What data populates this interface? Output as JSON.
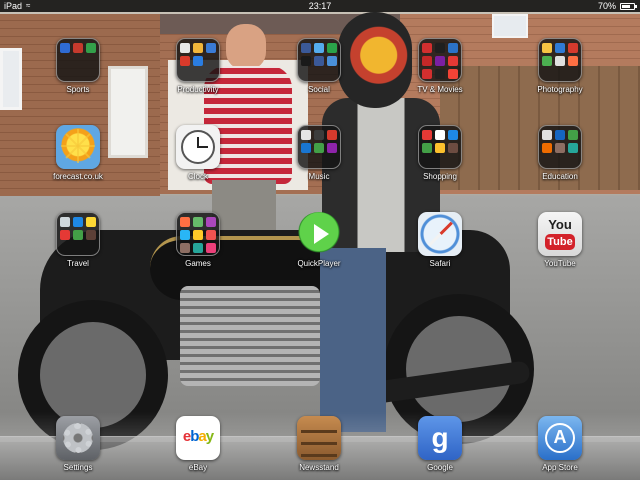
{
  "status_bar": {
    "carrier": "iPad",
    "time": "23:17",
    "battery_percent": "70%",
    "battery_level": 0.7
  },
  "home_screen": {
    "rows": [
      [
        {
          "label": "Sports",
          "type": "folder",
          "icon": "sports-folder-icon",
          "minis": [
            "#2f6bd3",
            "#c53a2d",
            "#33a04a"
          ]
        },
        {
          "label": "Productivity",
          "type": "folder",
          "icon": "productivity-folder-icon",
          "minis": [
            "#e7e7e7",
            "#f2b63a",
            "#3a7bd5",
            "#d93a2b",
            "#2a7de1"
          ]
        },
        {
          "label": "Social",
          "type": "folder",
          "icon": "social-folder-icon",
          "minis": [
            "#3b5998",
            "#55acee",
            "#2aa34a",
            "#1a1a1a",
            "#3b5998",
            "#4a90d9"
          ]
        },
        {
          "label": "TV & Movies",
          "type": "folder",
          "icon": "tv-movies-folder-icon",
          "minis": [
            "#d32f2f",
            "#1f1f1f",
            "#2b72c8",
            "#c62828",
            "#7b1fa2",
            "#e53935",
            "#d32f2f",
            "#212121",
            "#f44336"
          ]
        },
        {
          "label": "Photography",
          "type": "folder",
          "icon": "photography-folder-icon",
          "minis": [
            "#f6c343",
            "#2f7ad6",
            "#d63a2d",
            "#4caf50",
            "#e0e0e0",
            "#ff7043"
          ]
        }
      ],
      [
        {
          "label": "forecast.co.uk",
          "type": "app",
          "icon": "sun-weather-icon"
        },
        {
          "label": "Clock",
          "type": "app",
          "icon": "clock-icon"
        },
        {
          "label": "Music",
          "type": "folder",
          "icon": "music-folder-icon",
          "minis": [
            "#e6e6e6",
            "#3c3c3c",
            "#d63a2d",
            "#1976d2",
            "#43a047",
            "#8e24aa"
          ]
        },
        {
          "label": "Shopping",
          "type": "folder",
          "icon": "shopping-folder-icon",
          "minis": [
            "#e53935",
            "#ffffff",
            "#1e88e5",
            "#43a047",
            "#fbc02d",
            "#6d4c41"
          ]
        },
        {
          "label": "Education",
          "type": "folder",
          "icon": "education-folder-icon",
          "minis": [
            "#e0e0e0",
            "#1565c0",
            "#43a047",
            "#ef6c00",
            "#8d6e63",
            "#26a69a"
          ]
        }
      ],
      [
        {
          "label": "Travel",
          "type": "folder",
          "icon": "travel-folder-icon",
          "minis": [
            "#cfd8dc",
            "#1e88e5",
            "#fdd835",
            "#e53935",
            "#43a047",
            "#5d4037"
          ]
        },
        {
          "label": "Games",
          "type": "folder",
          "icon": "games-folder-icon",
          "minis": [
            "#ff7043",
            "#66bb6a",
            "#ab47bc",
            "#29b6f6",
            "#ffca28",
            "#ef5350",
            "#8d6e63",
            "#26a69a",
            "#ec407a"
          ]
        },
        {
          "label": "QuickPlayer",
          "type": "app",
          "icon": "play-button-icon"
        },
        {
          "label": "Safari",
          "type": "app",
          "icon": "compass-icon"
        },
        {
          "label": "YouTube",
          "type": "app",
          "icon": "youtube-icon",
          "icon_text_top": "You",
          "icon_text_bottom": "Tube"
        }
      ]
    ]
  },
  "dock": {
    "apps": [
      {
        "label": "Settings",
        "icon": "gear-icon"
      },
      {
        "label": "eBay",
        "icon": "ebay-icon",
        "logo_letters": [
          {
            "ch": "e",
            "color": "#e53238"
          },
          {
            "ch": "b",
            "color": "#0064d2"
          },
          {
            "ch": "a",
            "color": "#f5af02"
          },
          {
            "ch": "y",
            "color": "#86b817"
          }
        ]
      },
      {
        "label": "Newsstand",
        "icon": "newsstand-shelf-icon"
      },
      {
        "label": "Google",
        "icon": "google-icon",
        "icon_text": "g"
      },
      {
        "label": "App Store",
        "icon": "app-store-icon",
        "icon_text": "A"
      }
    ]
  }
}
